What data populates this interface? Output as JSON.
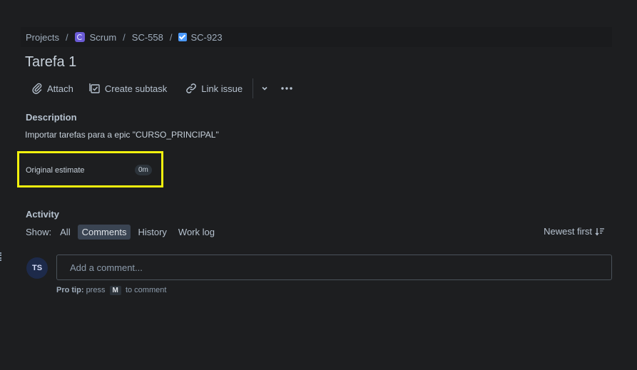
{
  "breadcrumb": {
    "projects": "Projects",
    "project": "Scrum",
    "epic": "SC-558",
    "issue": "SC-923",
    "separator": "/"
  },
  "issue": {
    "title": "Tarefa 1"
  },
  "toolbar": {
    "attach": "Attach",
    "create_subtask": "Create subtask",
    "link_issue": "Link issue"
  },
  "description": {
    "label": "Description",
    "text": "Importar tarefas para a epic \"CURSO_PRINCIPAL\""
  },
  "estimate": {
    "label": "Original estimate",
    "value": "0m"
  },
  "activity": {
    "label": "Activity",
    "show_label": "Show:",
    "filters": [
      "All",
      "Comments",
      "History",
      "Work log"
    ],
    "active_filter": "Comments",
    "sort": "Newest first"
  },
  "comment": {
    "avatar_initials": "TS",
    "placeholder": "Add a comment...",
    "pro_tip_prefix": "Pro tip:",
    "pro_tip_press": "press",
    "pro_tip_key": "M",
    "pro_tip_suffix": "to comment"
  },
  "colors": {
    "background": "#1d1e20",
    "highlight": "#f1f10e",
    "active_filter_bg": "#3a4452"
  }
}
